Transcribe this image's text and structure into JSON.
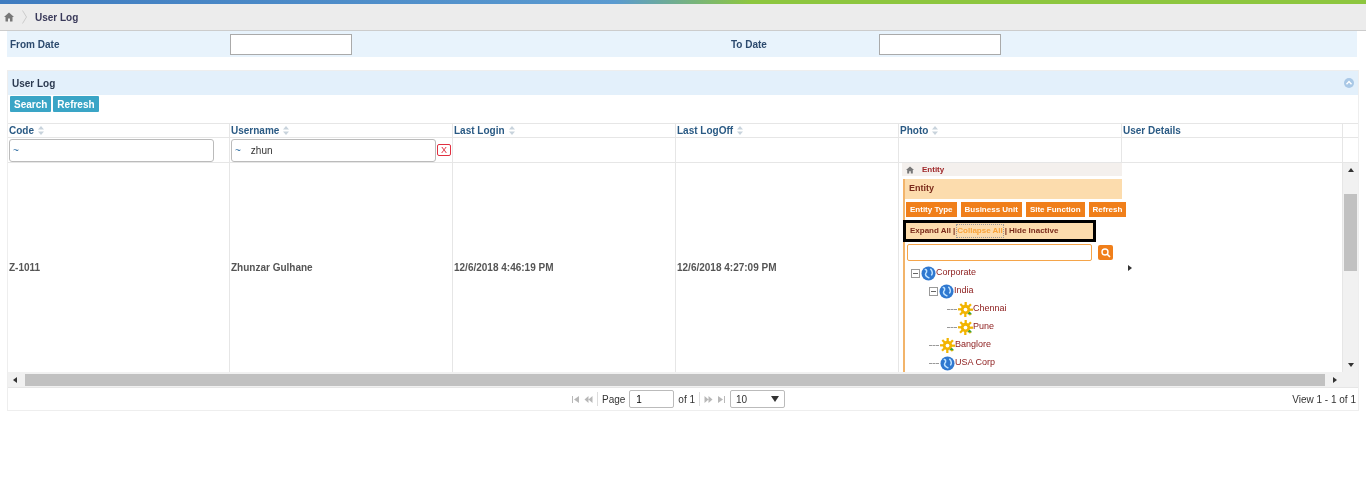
{
  "breadcrumb": {
    "title": "User Log"
  },
  "filters": [
    {
      "label": "From Date"
    },
    {
      "label": "To Date"
    }
  ],
  "panel": {
    "title": "User Log",
    "expanded": true
  },
  "toolbar": [
    "Search",
    "Refresh"
  ],
  "table": {
    "columns": [
      {
        "label": "Code",
        "sortable": true
      },
      {
        "label": "Username",
        "sortable": true
      },
      {
        "label": "Last Login",
        "sortable": true
      },
      {
        "label": "Last LogOff",
        "sortable": true
      },
      {
        "label": "Photo",
        "sortable": true
      },
      {
        "label": "User Details",
        "sortable": false
      }
    ],
    "filter_row": [
      {
        "operator": "~"
      },
      {
        "operator": "~",
        "value": "zhun",
        "clear": "X"
      }
    ],
    "rows": [
      {
        "code": "Z-1011",
        "username": "Zhunzar Gulhane",
        "last_login": "12/6/2018 4:46:19 PM",
        "last_logoff": "12/6/2018 4:27:09 PM",
        "photo": {
          "breadcrumb": "Entity",
          "title": "Entity",
          "buttons": [
            "Entity Type",
            "Business Unit",
            "Site Function",
            "Refresh"
          ],
          "links": [
            {
              "label": "Expand All",
              "selected": false
            },
            {
              "label": "Collapse All",
              "selected": true
            },
            {
              "label": "Hide Inactive",
              "selected": false
            }
          ],
          "separator": "|",
          "tree": [
            {
              "label": "Corporate",
              "kind": "globe",
              "expanded": true,
              "children": [
                {
                  "label": "India",
                  "kind": "globe",
                  "expanded": true,
                  "children": [
                    {
                      "label": "Chennai",
                      "kind": "gear"
                    },
                    {
                      "label": "Pune",
                      "kind": "gear"
                    }
                  ]
                },
                {
                  "label": "Banglore",
                  "kind": "gear"
                },
                {
                  "label": "USA Corp",
                  "kind": "globe"
                }
              ]
            }
          ]
        }
      }
    ]
  },
  "pager": {
    "page_label": "Page",
    "page": "1",
    "of": "of 1",
    "page_size": "10",
    "summary": "View 1 - 1 of 1"
  }
}
